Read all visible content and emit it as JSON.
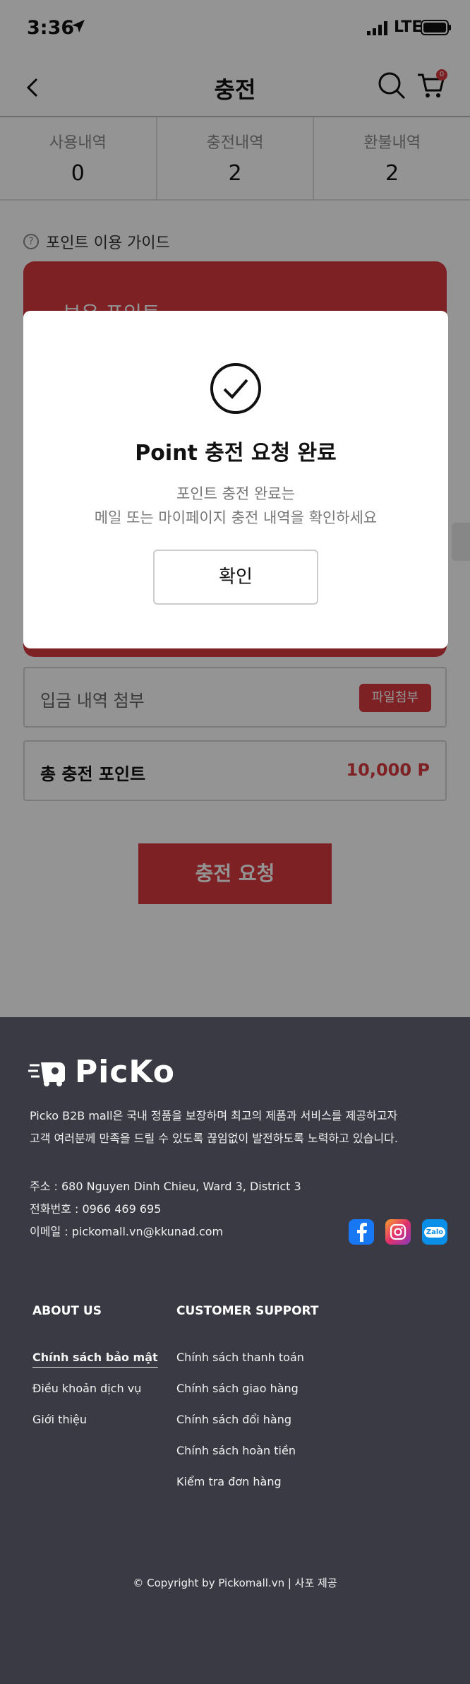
{
  "status_bar": {
    "time": "3:36",
    "network": "LTE"
  },
  "header": {
    "title": "충전",
    "cart_count": "0"
  },
  "summary": [
    {
      "label": "사용내역",
      "value": "0"
    },
    {
      "label": "충전내역",
      "value": "2"
    },
    {
      "label": "환불내역",
      "value": "2"
    }
  ],
  "guide_link": "포인트 이용 가이드",
  "card_title": "보유 포인트",
  "attach": {
    "label": "입금 내역 첨부",
    "button": "파일첨부"
  },
  "total": {
    "label": "총 충전 포인트",
    "value": "10,000 P"
  },
  "submit_label": "충전 요청",
  "modal": {
    "title": "Point 충전 요청 완료",
    "desc_line1": "포인트 충전 완료는",
    "desc_line2": "메일 또는 마이페이지 충전 내역을 확인하세요",
    "confirm": "확인"
  },
  "footer": {
    "brand": "PicKo",
    "desc_line1": "Picko B2B mall은 국내 정품을 보장하며 최고의 제품과 서비스를 제공하고자",
    "desc_line2": "고객 여러분께 만족을 드릴 수 있도록 끊임없이 발전하도록 노력하고 있습니다.",
    "address": "주소 : 680 Nguyen Dinh Chieu, Ward 3, District 3",
    "phone": "전화번호 : 0966 469 695",
    "email": "이메일 : pickomall.vn@kkunad.com",
    "social": [
      "facebook-icon",
      "instagram-icon",
      "zalo-icon"
    ],
    "zalo_text": "Zalo",
    "about": {
      "heading": "ABOUT US",
      "links": [
        "Chính sách bảo mật",
        "Điều khoản dịch vụ",
        "Giới thiệu"
      ]
    },
    "support": {
      "heading": "CUSTOMER SUPPORT",
      "links": [
        "Chính sách thanh toán",
        "Chính sách giao hàng",
        "Chính sách đổi hàng",
        "Chính sách hoàn tiền",
        "Kiểm tra đơn hàng"
      ]
    },
    "copyright": "© Copyright by Pickomall.vn | 사포 제공"
  },
  "colors": {
    "accent": "#d9393e",
    "footer_bg": "#3a3a44"
  }
}
